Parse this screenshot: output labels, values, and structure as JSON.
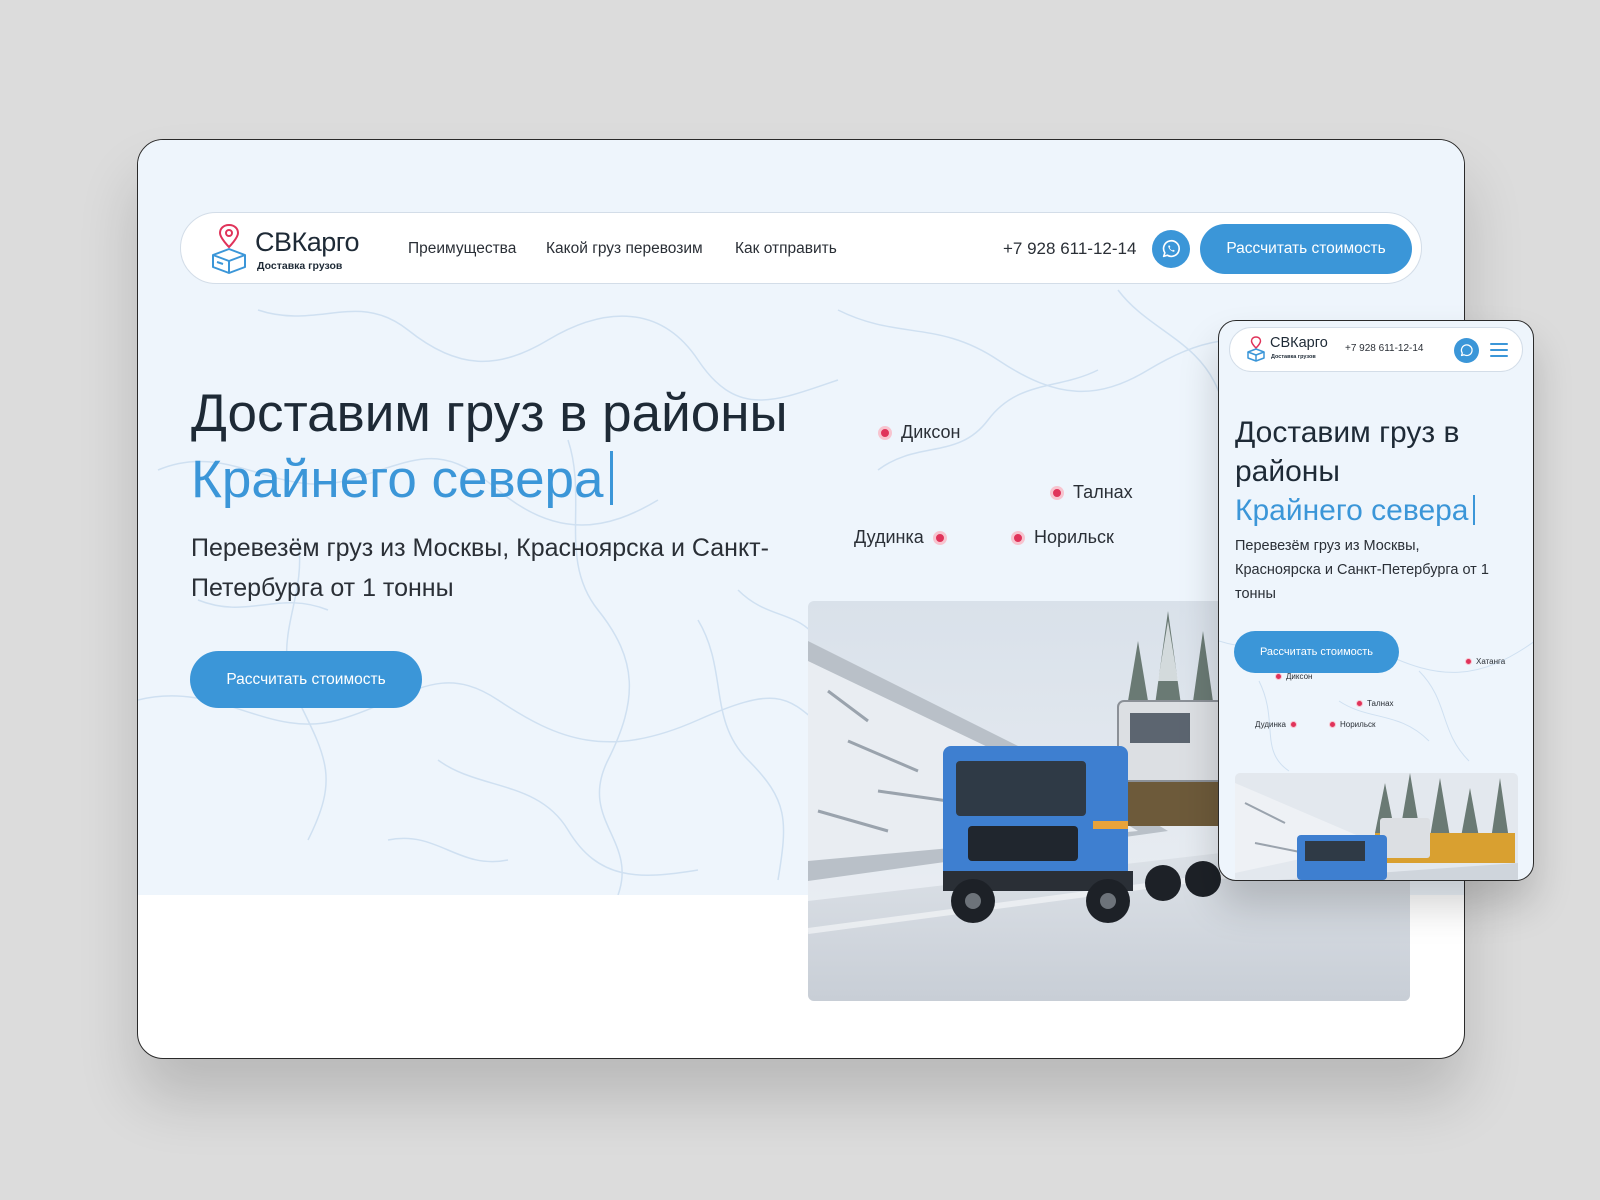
{
  "brand": {
    "name": "СВКарго",
    "tagline": "Доставка грузов"
  },
  "nav": {
    "links": [
      "Преимущества",
      "Какой груз перевозим",
      "Как отправить"
    ],
    "phone": "+7 928 611-12-14",
    "cta_label": "Рассчитать стоимость"
  },
  "hero": {
    "headline": "Доставим груз в районы",
    "headline_accent": "Крайнего севера",
    "lead": "Перевезём груз из Москвы, Красноярска и Санкт-Петербурга от 1 тонны",
    "cta_label": "Рассчитать стоимость"
  },
  "map": {
    "cities": [
      "Диксон",
      "Талнах",
      "Дудинка",
      "Норильск"
    ]
  },
  "mobile": {
    "brand_name": "СВКарго",
    "brand_tagline": "Доставка грузов",
    "phone": "+7 928 611-12-14",
    "headline": "Доставим груз в районы",
    "headline_accent": "Крайнего севера",
    "lead": "Перевезём груз из Москвы, Красноярска и Санкт-Петербурга от 1 тонны",
    "cta_label": "Рассчитать стоимость",
    "cities": [
      "Хатанга",
      "Диксон",
      "Талнах",
      "Дудинка",
      "Норильск"
    ]
  },
  "colors": {
    "accent": "#3b96d8",
    "marker": "#e0335a",
    "hero_bg": "#eef5fc",
    "text": "#1e2a36"
  },
  "icons": {
    "logo": "location-pin-box-icon",
    "messenger": "whatsapp-icon",
    "menu": "hamburger-icon"
  }
}
